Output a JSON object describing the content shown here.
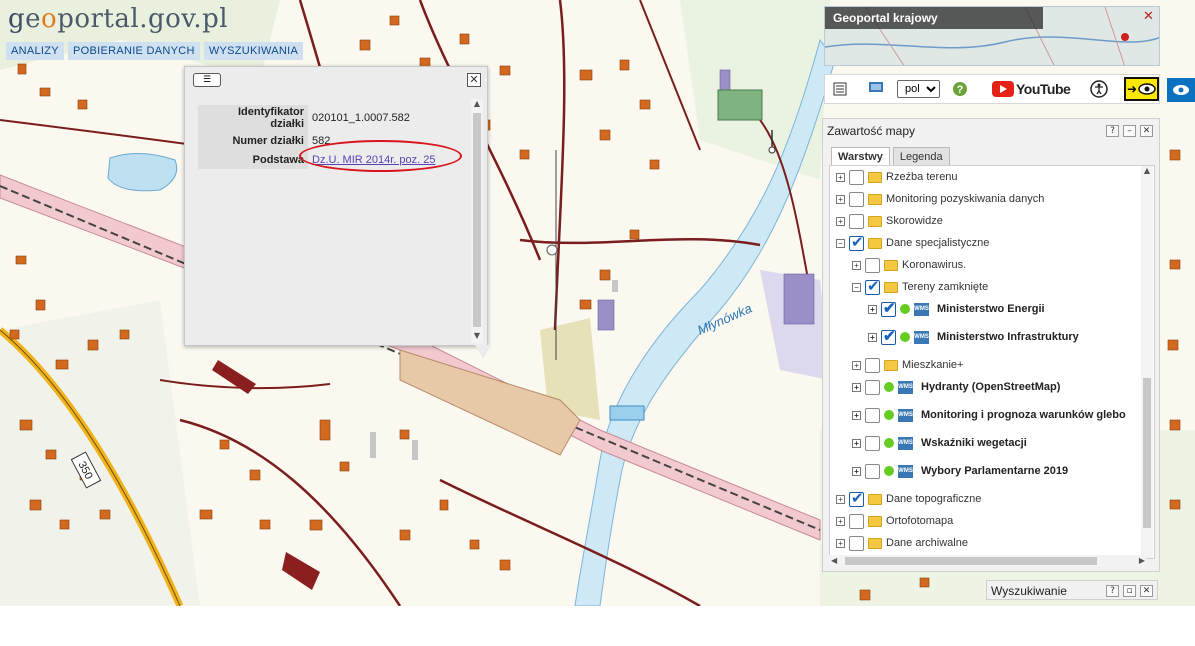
{
  "logo": {
    "g": "g",
    "e": "e",
    "o": "o",
    "rest": "portal.gov.pl"
  },
  "topnav": [
    "ANALIZY",
    "POBIERANIE DANYCH",
    "WYSZUKIWANIA"
  ],
  "popup": {
    "rows": [
      {
        "key": "Identyfikator działki",
        "value": "020101_1.0007.582"
      },
      {
        "key": "Numer działki",
        "value": "582"
      },
      {
        "key": "Podstawa",
        "value": "Dz.U. MIR 2014r. poz. 25"
      }
    ]
  },
  "geoportal_krajowy": {
    "title": "Geoportal krajowy"
  },
  "toolbar": {
    "language": "pol",
    "youtube": "YouTube",
    "wms_label": "WMS"
  },
  "map_labels": {
    "river": "Młynówka",
    "road": "350"
  },
  "layers_panel": {
    "title": "Zawartość mapy",
    "tabs": [
      "Warstwy",
      "Legenda"
    ],
    "items": [
      {
        "label": "Rzeźba terenu",
        "level": 0,
        "checked": false,
        "type": "folder",
        "bold": false
      },
      {
        "label": "Monitoring pozyskiwania danych",
        "level": 0,
        "checked": false,
        "type": "folder",
        "bold": false
      },
      {
        "label": "Skorowidze",
        "level": 0,
        "checked": false,
        "type": "folder",
        "bold": false
      },
      {
        "label": "Dane specjalistyczne",
        "level": 0,
        "checked": true,
        "type": "folder",
        "bold": false,
        "expanded": true
      },
      {
        "label": "Koronawirus.",
        "level": 1,
        "checked": false,
        "type": "folder",
        "bold": false
      },
      {
        "label": "Tereny zamknięte",
        "level": 1,
        "checked": true,
        "type": "folder",
        "bold": false,
        "expanded": true
      },
      {
        "label": "Ministerstwo Energii",
        "level": 2,
        "checked": true,
        "type": "wms",
        "bold": true
      },
      {
        "label": "Ministerstwo Infrastruktury",
        "level": 2,
        "checked": true,
        "type": "wms",
        "bold": true
      },
      {
        "label": "Mieszkanie+",
        "level": 1,
        "checked": false,
        "type": "folder",
        "bold": false
      },
      {
        "label": "Hydranty (OpenStreetMap)",
        "level": 1,
        "checked": false,
        "type": "wms",
        "bold": true
      },
      {
        "label": "Monitoring i prognoza warunków glebo",
        "level": 1,
        "checked": false,
        "type": "wms",
        "bold": true
      },
      {
        "label": "Wskaźniki wegetacji",
        "level": 1,
        "checked": false,
        "type": "wms",
        "bold": true
      },
      {
        "label": "Wybory Parlamentarne 2019",
        "level": 1,
        "checked": false,
        "type": "wms",
        "bold": true
      },
      {
        "label": "Dane topograficzne",
        "level": 0,
        "checked": true,
        "type": "folder",
        "bold": false
      },
      {
        "label": "Ortofotomapa",
        "level": 0,
        "checked": false,
        "type": "folder",
        "bold": false
      },
      {
        "label": "Dane archiwalne",
        "level": 0,
        "checked": false,
        "type": "folder",
        "bold": false
      }
    ]
  },
  "search_panel": {
    "title": "Wyszukiwanie"
  },
  "colors": {
    "accent": "#0c4a8a",
    "highlight_ellipse": "#d8141c",
    "railway": "#f2c9cf",
    "water": "#cfe8f5",
    "building": "#d2691e"
  }
}
